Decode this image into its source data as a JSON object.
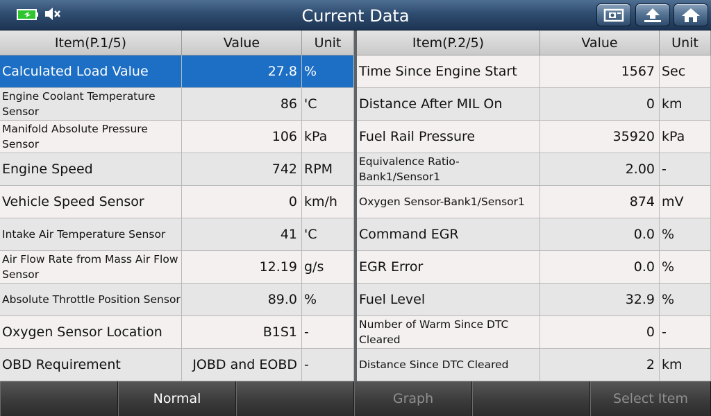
{
  "title": "Current Data",
  "status": {
    "battery_icon": "battery-charging-icon",
    "sound_icon": "speaker-muted-icon",
    "battery_color": "#2ec52e"
  },
  "toolbar": {
    "buttons": [
      "screenshot-icon",
      "upload-icon",
      "home-icon"
    ]
  },
  "left_table": {
    "headers": {
      "item": "Item(P.1/5)",
      "value": "Value",
      "unit": "Unit"
    },
    "rows": [
      {
        "item": "Calculated Load Value",
        "value": "27.8",
        "unit": "%"
      },
      {
        "item": "Engine Coolant Temperature Sensor",
        "value": "86",
        "unit": "'C"
      },
      {
        "item": "Manifold Absolute Pressure Sensor",
        "value": "106",
        "unit": "kPa"
      },
      {
        "item": "Engine Speed",
        "value": "742",
        "unit": "RPM"
      },
      {
        "item": "Vehicle Speed Sensor",
        "value": "0",
        "unit": "km/h"
      },
      {
        "item": "Intake Air Temperature Sensor",
        "value": "41",
        "unit": "'C"
      },
      {
        "item": "Air Flow Rate from Mass Air Flow Sensor",
        "value": "12.19",
        "unit": "g/s"
      },
      {
        "item": "Absolute Throttle Position Sensor",
        "value": "89.0",
        "unit": "%"
      },
      {
        "item": "Oxygen Sensor Location",
        "value": "B1S1",
        "unit": "-"
      },
      {
        "item": "OBD Requirement",
        "value": "JOBD and EOBD",
        "unit": "-"
      }
    ]
  },
  "right_table": {
    "headers": {
      "item": "Item(P.2/5)",
      "value": "Value",
      "unit": "Unit"
    },
    "rows": [
      {
        "item": "Time Since Engine Start",
        "value": "1567",
        "unit": "Sec"
      },
      {
        "item": "Distance After MIL On",
        "value": "0",
        "unit": "km"
      },
      {
        "item": "Fuel Rail Pressure",
        "value": "35920",
        "unit": "kPa"
      },
      {
        "item": "Equivalence Ratio-Bank1/Sensor1",
        "value": "2.00",
        "unit": "-"
      },
      {
        "item": "Oxygen Sensor-Bank1/Sensor1",
        "value": "874",
        "unit": "mV"
      },
      {
        "item": "Command EGR",
        "value": "0.0",
        "unit": "%"
      },
      {
        "item": "EGR Error",
        "value": "0.0",
        "unit": "%"
      },
      {
        "item": "Fuel Level",
        "value": "32.9",
        "unit": "%"
      },
      {
        "item": "Number of Warm Since DTC Cleared",
        "value": "0",
        "unit": "-"
      },
      {
        "item": "Distance Since DTC Cleared",
        "value": "2",
        "unit": "km"
      }
    ]
  },
  "bottom_bar": {
    "blank1": "",
    "normal": "Normal",
    "blank2": "",
    "graph": "Graph",
    "blank3": "",
    "select_item": "Select Item"
  },
  "selected_color": "#1c6fc4"
}
